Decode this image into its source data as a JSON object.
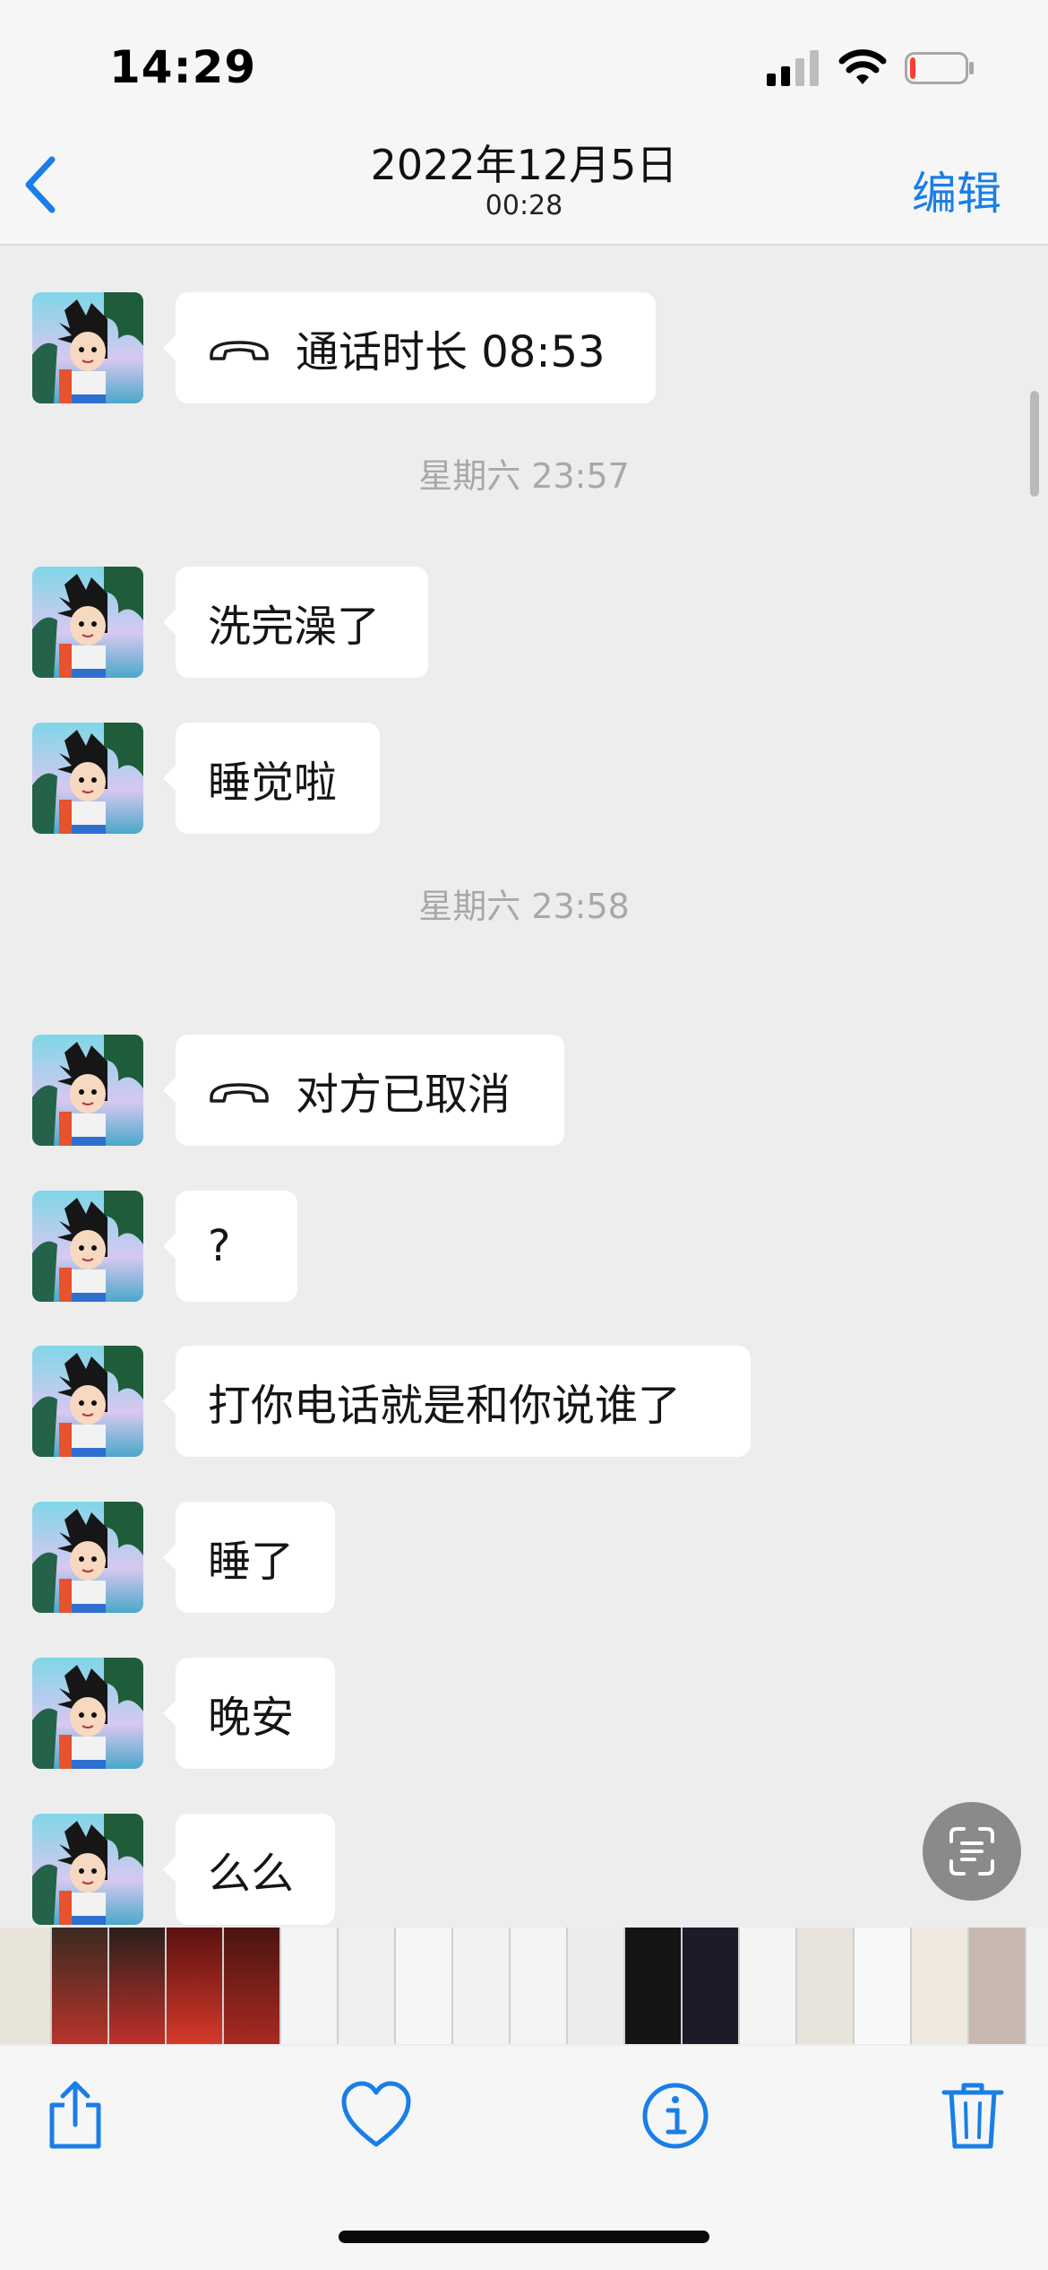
{
  "status_bar": {
    "time": "14:29",
    "battery_level": 0.1,
    "battery_color": "#ff3b30"
  },
  "header": {
    "date": "2022年12月5日",
    "time": "00:28",
    "edit_label": "编辑",
    "accent_color": "#1a7ee6"
  },
  "messages": [
    {
      "type": "call",
      "text": "通话时长 08:53"
    },
    {
      "type": "timestamp",
      "text": "星期六 23:57"
    },
    {
      "type": "text",
      "text": "洗完澡了"
    },
    {
      "type": "text",
      "text": "睡觉啦"
    },
    {
      "type": "timestamp",
      "text": "星期六 23:58"
    },
    {
      "type": "call",
      "text": "对方已取消"
    },
    {
      "type": "text",
      "text": "?"
    },
    {
      "type": "text",
      "text": "打你电话就是和你说谁了"
    },
    {
      "type": "text",
      "text": "睡了"
    },
    {
      "type": "text",
      "text": "晚安"
    },
    {
      "type": "text",
      "text": "么么"
    }
  ],
  "icons": {
    "back": "chevron-left-icon",
    "call": "phone-hangup-icon",
    "live_text": "live-text-icon",
    "share": "share-icon",
    "favorite": "heart-icon",
    "info": "info-icon",
    "delete": "trash-icon"
  }
}
